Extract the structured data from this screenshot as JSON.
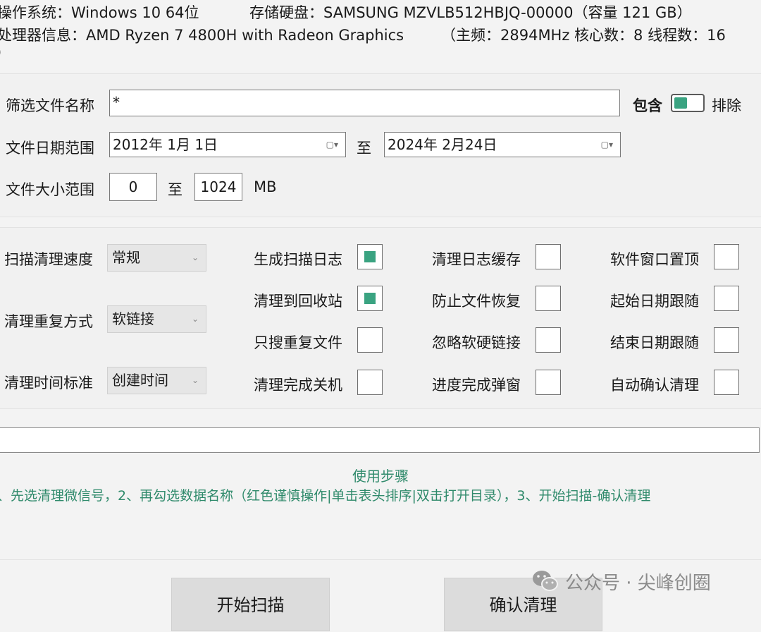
{
  "sysinfo": {
    "os_label": "操作系统：",
    "os_value": "Windows 10 64位",
    "disk_label": "存储硬盘：",
    "disk_value": "SAMSUNG MZVLB512HBJQ-00000（容量 121 GB）",
    "cpu_label": "处理器信息：",
    "cpu_value": "AMD Ryzen 7 4800H with Radeon Graphics",
    "cpu_extra": "（主频：2894MHz   核心数：8   线程数：16",
    "cpu_tail": ")"
  },
  "filter": {
    "name_label": "筛选文件名称",
    "name_value": "*",
    "include_label": "包含",
    "exclude_label": "排除",
    "toggle_on": true,
    "date_label": "文件日期范围",
    "date_from": "2012年  1月  1日",
    "date_to_sep": "至",
    "date_to": "2024年  2月24日",
    "size_label": "文件大小范围",
    "size_from": "0",
    "size_sep": "至",
    "size_to": "1024",
    "size_unit": "MB"
  },
  "options": {
    "speed_label": "扫描清理速度",
    "speed_value": "常规",
    "dup_label": "清理重复方式",
    "dup_value": "软链接",
    "time_label": "清理时间标准",
    "time_value": "创建时间",
    "checks": [
      {
        "label": "生成扫描日志",
        "checked": true
      },
      {
        "label": "清理日志缓存",
        "checked": false
      },
      {
        "label": "软件窗口置顶",
        "checked": false
      },
      {
        "label": "清理到回收站",
        "checked": true
      },
      {
        "label": "防止文件恢复",
        "checked": false
      },
      {
        "label": "起始日期跟随",
        "checked": false
      },
      {
        "label": "只搜重复文件",
        "checked": false
      },
      {
        "label": "忽略软硬链接",
        "checked": false
      },
      {
        "label": "结束日期跟随",
        "checked": false
      },
      {
        "label": "清理完成关机",
        "checked": false
      },
      {
        "label": "进度完成弹窗",
        "checked": false
      },
      {
        "label": "自动确认清理",
        "checked": false
      }
    ]
  },
  "steps": {
    "title": "使用步骤",
    "text": "、先选清理微信号，2、再勾选数据名称（红色谨慎操作|单击表头排序|双击打开目录），3、开始扫描-确认清理"
  },
  "buttons": {
    "scan": "开始扫描",
    "confirm": "确认清理"
  },
  "watermark": {
    "text": "公众号 · 尖峰创圈",
    "icon": "wechat-icon"
  },
  "colors": {
    "accent": "#3aa381",
    "steps_text": "#2f8a6b"
  }
}
